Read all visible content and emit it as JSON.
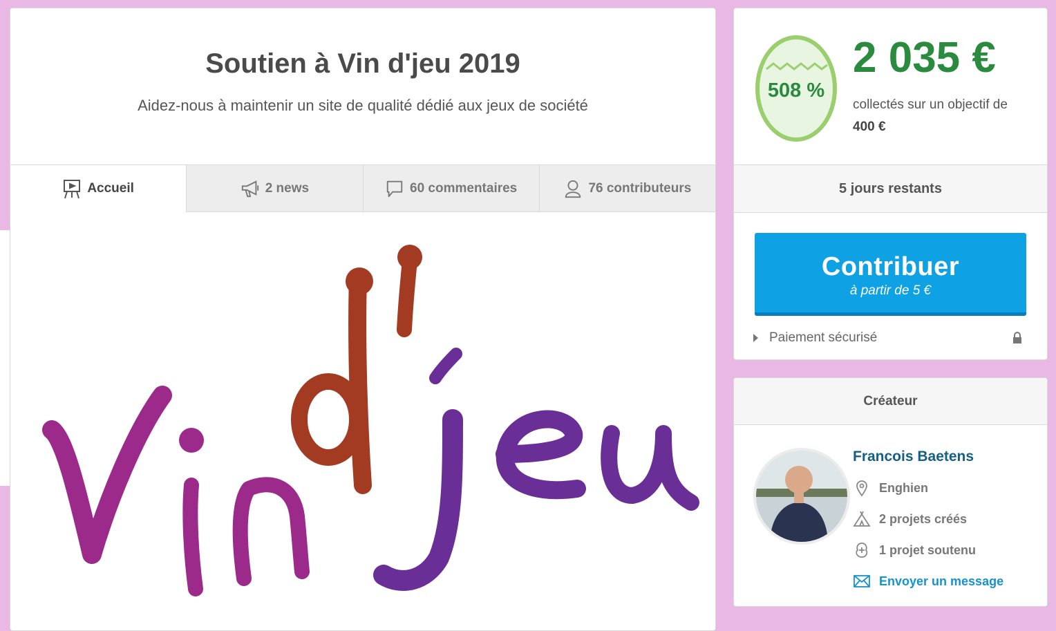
{
  "project": {
    "title": "Soutien à Vin d'jeu 2019",
    "subtitle": "Aidez-nous à maintenir un site de qualité dédié aux jeux de société"
  },
  "tabs": [
    {
      "label": "Accueil",
      "icon": "easel-icon",
      "active": true
    },
    {
      "label": "2 news",
      "icon": "megaphone-icon",
      "active": false
    },
    {
      "label": "60 commentaires",
      "icon": "speech-bubble-icon",
      "active": false
    },
    {
      "label": "76 contributeurs",
      "icon": "person-icon",
      "active": false
    }
  ],
  "logo": {
    "text": "Vin d'jeu"
  },
  "funding": {
    "percent": "508 %",
    "amount": "2 035 €",
    "collected_text": "collectés sur un objectif de",
    "goal": "400 €",
    "days_left": "5 jours restants",
    "contribute_label": "Contribuer",
    "contribute_sub": "à partir de 5 €",
    "secure_label": "Paiement sécurisé",
    "accent_color": "#2a8a3e",
    "button_color": "#0ea1e4"
  },
  "creator": {
    "heading": "Créateur",
    "name": "Francois Baetens",
    "location": "Enghien",
    "projects_created": "2 projets créés",
    "projects_supported": "1 projet soutenu",
    "message_label": "Envoyer un message"
  }
}
